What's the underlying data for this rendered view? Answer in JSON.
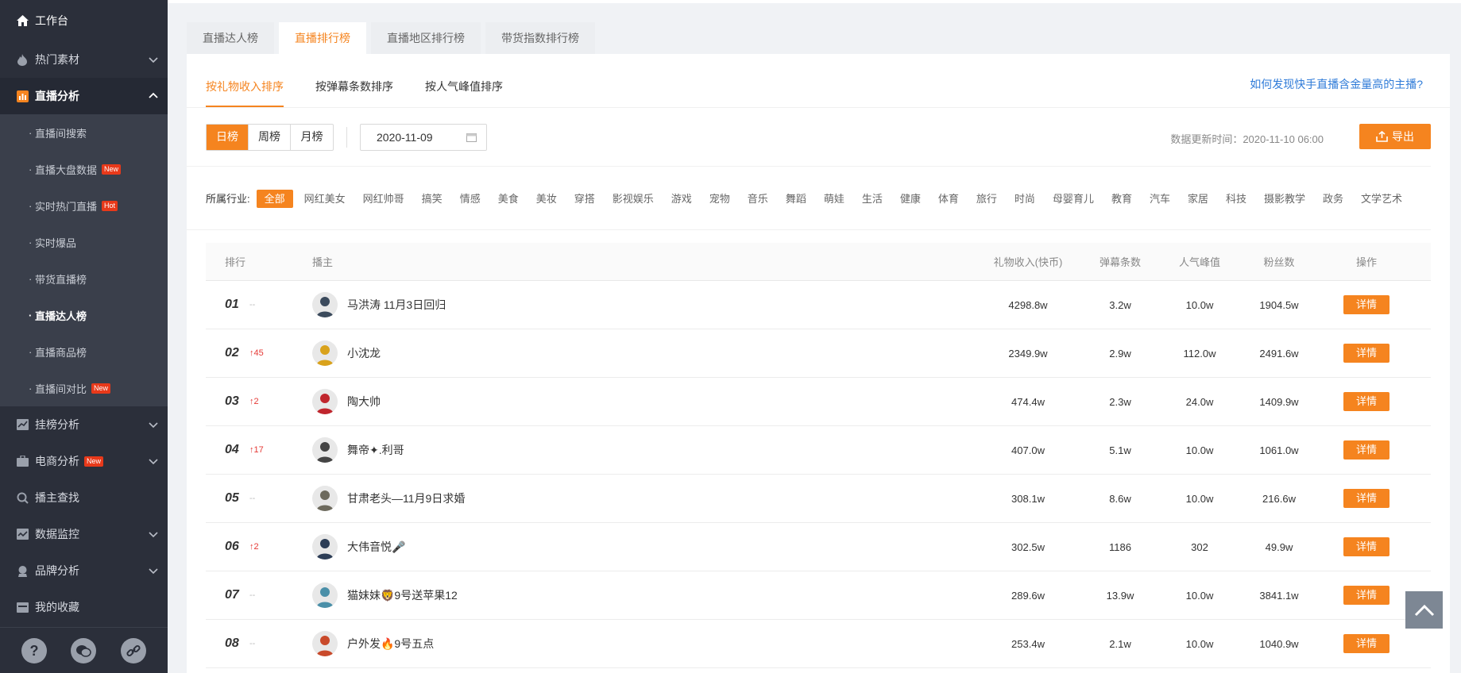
{
  "sidebar": {
    "workbench": "工作台",
    "hot_material": "热门素材",
    "live_analysis": "直播分析",
    "sub_items": [
      {
        "label": "直播间搜索",
        "badge": ""
      },
      {
        "label": "直播大盘数据",
        "badge": "New"
      },
      {
        "label": "实时热门直播",
        "badge": "Hot"
      },
      {
        "label": "实时爆品",
        "badge": ""
      },
      {
        "label": "带货直播榜",
        "badge": ""
      },
      {
        "label": "直播达人榜",
        "badge": ""
      },
      {
        "label": "直播商品榜",
        "badge": ""
      },
      {
        "label": "直播间对比",
        "badge": "New"
      }
    ],
    "bottom_items": [
      {
        "label": "挂榜分析",
        "badge": ""
      },
      {
        "label": "电商分析",
        "badge": "New"
      },
      {
        "label": "播主查找",
        "badge": ""
      },
      {
        "label": "数据监控",
        "badge": ""
      },
      {
        "label": "品牌分析",
        "badge": ""
      },
      {
        "label": "我的收藏",
        "badge": ""
      }
    ],
    "footer_icons": [
      "help-icon",
      "wechat-icon",
      "link-icon"
    ]
  },
  "tabs": [
    "直播达人榜",
    "直播排行榜",
    "直播地区排行榜",
    "带货指数排行榜"
  ],
  "subtabs": [
    "按礼物收入排序",
    "按弹幕条数排序",
    "按人气峰值排序"
  ],
  "help_link": "如何发现快手直播含金量高的主播?",
  "period": [
    "日榜",
    "周榜",
    "月榜"
  ],
  "date": "2020-11-09",
  "update_time": "数据更新时间：2020-11-10 06:00",
  "export_label": "导出",
  "industry_label": "所属行业:",
  "industries": [
    "全部",
    "网红美女",
    "网红帅哥",
    "搞笑",
    "情感",
    "美食",
    "美妆",
    "穿搭",
    "影视娱乐",
    "游戏",
    "宠物",
    "音乐",
    "舞蹈",
    "萌娃",
    "生活",
    "健康",
    "体育",
    "旅行",
    "时尚",
    "母婴育儿",
    "教育",
    "汽车",
    "家居",
    "科技",
    "摄影教学",
    "政务",
    "文学艺术"
  ],
  "table": {
    "headers": {
      "rank": "排行",
      "host": "播主",
      "gift": "礼物收入(快币)",
      "danmu": "弹幕条数",
      "pop": "人气峰值",
      "fans": "粉丝数",
      "op": "操作"
    },
    "detail_label": "详情",
    "rows": [
      {
        "rank": "01",
        "change": "--",
        "name": "马洪涛 11月3日回归",
        "gift": "4298.8w",
        "danmu": "3.2w",
        "pop": "10.0w",
        "fans": "1904.5w",
        "avatar_color": "#3b4a5c"
      },
      {
        "rank": "02",
        "change": "↑45",
        "name": "小沈龙",
        "gift": "2349.9w",
        "danmu": "2.9w",
        "pop": "112.0w",
        "fans": "2491.6w",
        "avatar_color": "#d9a21b"
      },
      {
        "rank": "03",
        "change": "↑2",
        "name": "陶大帅",
        "gift": "474.4w",
        "danmu": "2.3w",
        "pop": "24.0w",
        "fans": "1409.9w",
        "avatar_color": "#c0262d"
      },
      {
        "rank": "04",
        "change": "↑17",
        "name": "舞帝✦.利哥",
        "gift": "407.0w",
        "danmu": "5.1w",
        "pop": "10.0w",
        "fans": "1061.0w",
        "avatar_color": "#444"
      },
      {
        "rank": "05",
        "change": "--",
        "name": "甘肃老头—11月9日求婚",
        "gift": "308.1w",
        "danmu": "8.6w",
        "pop": "10.0w",
        "fans": "216.6w",
        "avatar_color": "#6d6a5d"
      },
      {
        "rank": "06",
        "change": "↑2",
        "name": "大伟音悦🎤",
        "gift": "302.5w",
        "danmu": "1186",
        "pop": "302",
        "fans": "49.9w",
        "avatar_color": "#2c3d56"
      },
      {
        "rank": "07",
        "change": "--",
        "name": "猫妹妹🦁9号送苹果12",
        "gift": "289.6w",
        "danmu": "13.9w",
        "pop": "10.0w",
        "fans": "3841.1w",
        "avatar_color": "#4a8fa8"
      },
      {
        "rank": "08",
        "change": "--",
        "name": "户外发🔥9号五点",
        "gift": "253.4w",
        "danmu": "2.1w",
        "pop": "10.0w",
        "fans": "1040.9w",
        "avatar_color": "#c94a2b"
      }
    ]
  },
  "colors": {
    "accent": "#f5841f",
    "sidebar": "#2b2f3a",
    "link": "#2f7bd8",
    "up": "#e53935"
  }
}
